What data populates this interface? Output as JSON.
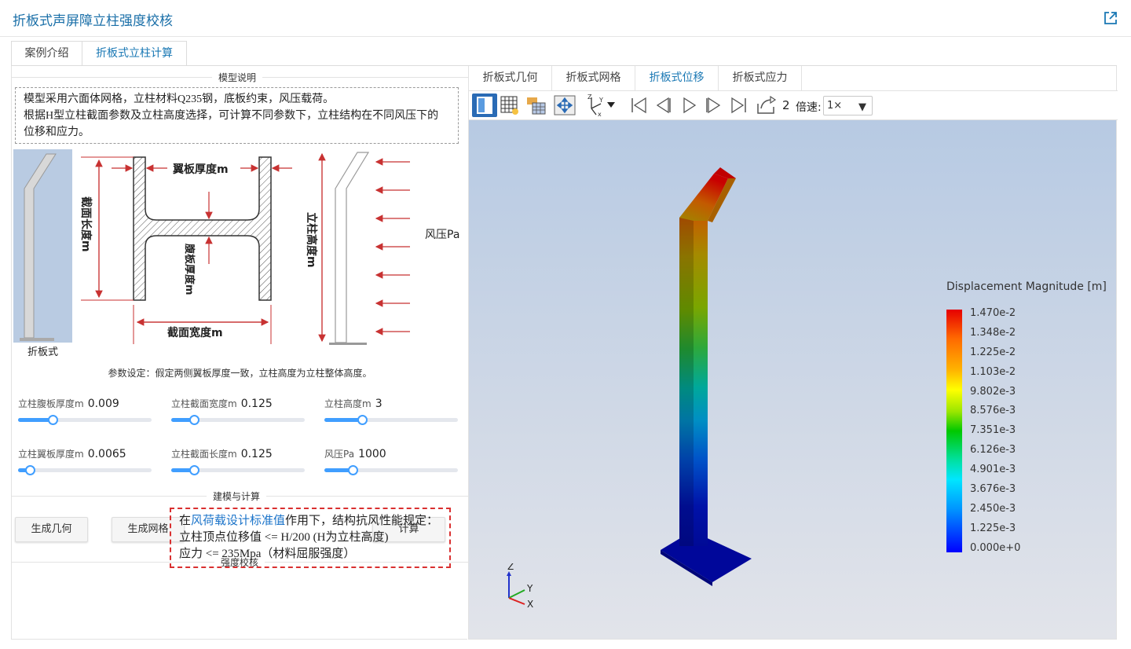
{
  "app": {
    "title": "折板式声屏障立柱强度校核"
  },
  "outer_tabs": [
    {
      "label": "案例介绍"
    },
    {
      "label": "折板式立柱计算"
    }
  ],
  "model_section": {
    "title": "模型说明",
    "lines": [
      "模型采用六面体网格，立柱材料Q235钢，底板约束，风压载荷。",
      "根据H型立柱截面参数及立柱高度选择，可计算不同参数下，立柱结构在不同风压下的",
      "位移和应力。"
    ]
  },
  "diagram": {
    "thumb_caption": "折板式",
    "flange_label": "翼板厚度m",
    "section_length_label": "截面长度m",
    "web_label": "腹板厚度m",
    "section_width_label": "截面宽度m",
    "height_label": "立柱高度m",
    "wind_label": "风压Pa"
  },
  "params": {
    "note": "参数设定：假定两侧翼板厚度一致，立柱高度为立柱整体高度。",
    "sliders": [
      {
        "label": "立柱腹板厚度m",
        "value": "0.009",
        "fraction": 0.26
      },
      {
        "label": "立柱截面宽度m",
        "value": "0.125",
        "fraction": 0.17
      },
      {
        "label": "立柱高度m",
        "value": "3",
        "fraction": 0.28
      },
      {
        "label": "立柱翼板厚度m",
        "value": "0.0065",
        "fraction": 0.09
      },
      {
        "label": "立柱截面长度m",
        "value": "0.125",
        "fraction": 0.17
      },
      {
        "label": "风压Pa",
        "value": "1000",
        "fraction": 0.21
      }
    ]
  },
  "compute_section": {
    "title": "建模与计算",
    "gen_geometry": "生成几何",
    "gen_mesh": "生成网格",
    "compute": "计算"
  },
  "strength_section": {
    "title": "强度校核",
    "prefix": "在",
    "link": "风荷载设计标准值",
    "suffix": "作用下，结构抗风性能规定：",
    "line2": "立柱顶点位移值 <= H/200 (H为立柱高度)",
    "line3": "应力 <= 235Mpa（材料屈服强度）"
  },
  "view_tabs": [
    {
      "label": "折板式几何"
    },
    {
      "label": "折板式网格"
    },
    {
      "label": "折板式位移"
    },
    {
      "label": "折板式应力"
    }
  ],
  "toolbar": {
    "frame": "2",
    "speed_label": "倍速:",
    "speed_value": "1×"
  },
  "legend": {
    "title": "Displacement Magnitude [m]",
    "values": [
      "1.470e-2",
      "1.348e-2",
      "1.225e-2",
      "1.103e-2",
      "9.802e-3",
      "8.576e-3",
      "7.351e-3",
      "6.126e-3",
      "4.901e-3",
      "3.676e-3",
      "2.450e-3",
      "1.225e-3",
      "0.000e+0"
    ]
  },
  "axes": {
    "x": "X",
    "y": "Y",
    "z": "Z"
  },
  "colors": {
    "accent": "#1a78b4",
    "slider": "#409eff",
    "dimension": "#c83232",
    "alert_border": "#d93030"
  }
}
